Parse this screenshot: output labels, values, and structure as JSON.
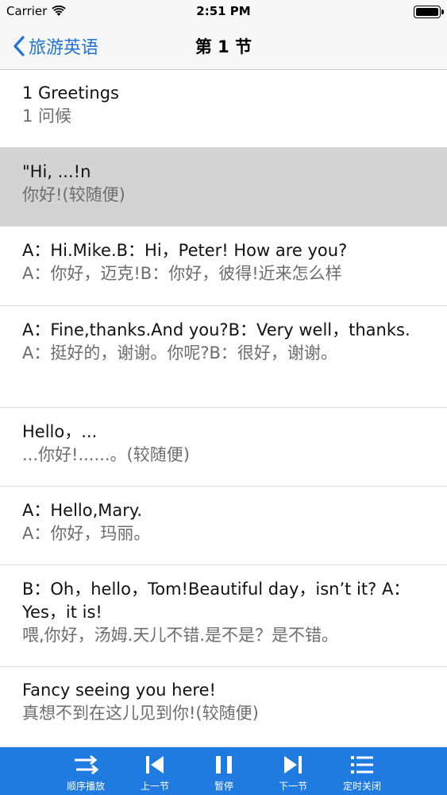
{
  "status": {
    "carrier": "Carrier",
    "time": "2:51 PM"
  },
  "nav": {
    "back_label": "旅游英语",
    "title": "第 1 节"
  },
  "rows": [
    {
      "en": "1 Greetings",
      "zh": "1 问候"
    },
    {
      "en": "\"Hi, ...!n",
      "zh": "你好!(较随便)"
    },
    {
      "en": "A：Hi.Mike.B：Hi，Peter! How are you?",
      "zh": "A：你好，迈克!B：你好，彼得!近来怎么样"
    },
    {
      "en": "A：Fine,thanks.And you?B：Very well，thanks.",
      "zh": "A：挺好的，谢谢。你呢?B：很好，谢谢。"
    },
    {
      "en": "Hello，...",
      "zh": "...你好!......。(较随便)"
    },
    {
      "en": "A：Hello,Mary.",
      "zh": "A：你好，玛丽。"
    },
    {
      "en": "B：Oh，hello，Tom!Beautiful day，isn’t it? A：Yes，it is!",
      "zh": "喂,你好，汤姆.天儿不错.是不是？是不错。"
    },
    {
      "en": "Fancy seeing you here!",
      "zh": "真想不到在这儿见到你!(较随便)"
    }
  ],
  "tabs": [
    {
      "label": "顺序播放",
      "icon": "shuffle-icon"
    },
    {
      "label": "上一节",
      "icon": "previous-icon"
    },
    {
      "label": "暂停",
      "icon": "pause-icon"
    },
    {
      "label": "下一节",
      "icon": "next-icon"
    },
    {
      "label": "定时关闭",
      "icon": "list-icon"
    }
  ],
  "colors": {
    "accent": "#1e73d8",
    "tab_bar": "#1f7be0",
    "selected_row": "#d3d3d3"
  }
}
